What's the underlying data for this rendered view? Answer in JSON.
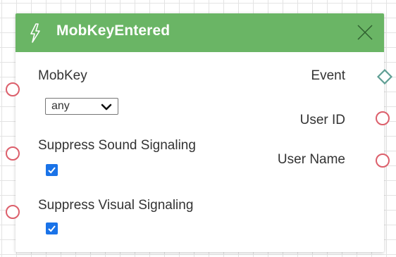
{
  "node": {
    "title": "MobKeyEntered",
    "header_color": "#6ab565",
    "icon": "lightning-bolt-icon",
    "close_icon": "close-icon"
  },
  "inputs": {
    "mobkey": {
      "label": "MobKey",
      "select_value": "any"
    },
    "suppress_sound": {
      "label": "Suppress Sound Signaling",
      "checked": true
    },
    "suppress_visual": {
      "label": "Suppress Visual Signaling",
      "checked": true
    }
  },
  "outputs": {
    "event": "Event",
    "user_id": "User ID",
    "user_name": "User Name"
  },
  "colors": {
    "port_border": "#dc5f6b",
    "event_port_border": "#5e9e93",
    "checkbox": "#1a73e8"
  }
}
